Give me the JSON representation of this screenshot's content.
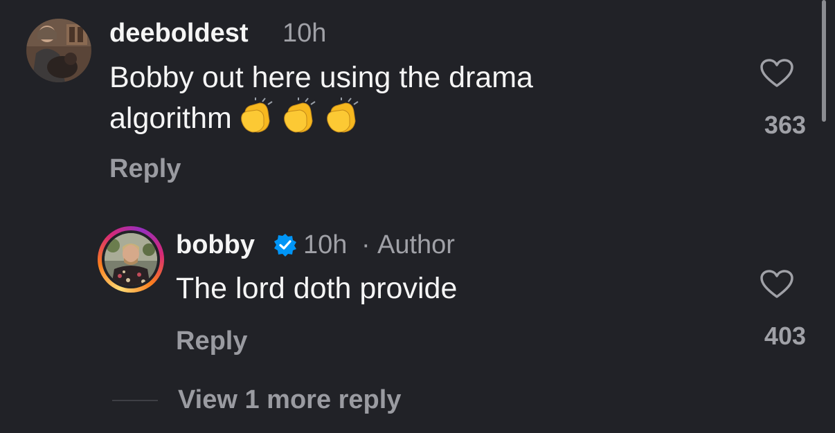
{
  "comments": [
    {
      "username": "deeboldest",
      "time": "10h",
      "text_line1": "Bobby out here using the drama",
      "text_line2": "algorithm",
      "emojis": [
        "clapping-hands",
        "clapping-hands",
        "clapping-hands"
      ],
      "reply_label": "Reply",
      "likes": "363",
      "like_icon": "heart-outline-icon"
    },
    {
      "username": "bobby",
      "verified": true,
      "time": "10h",
      "separator": "·",
      "role": "Author",
      "text": "The lord doth provide",
      "reply_label": "Reply",
      "likes": "403",
      "like_icon": "heart-outline-icon"
    }
  ],
  "view_more_label": "View 1 more reply",
  "colors": {
    "background": "#212227",
    "primary_text": "#f5f5f5",
    "secondary_text": "#a0a1a7",
    "verified_blue": "#0095f6"
  }
}
